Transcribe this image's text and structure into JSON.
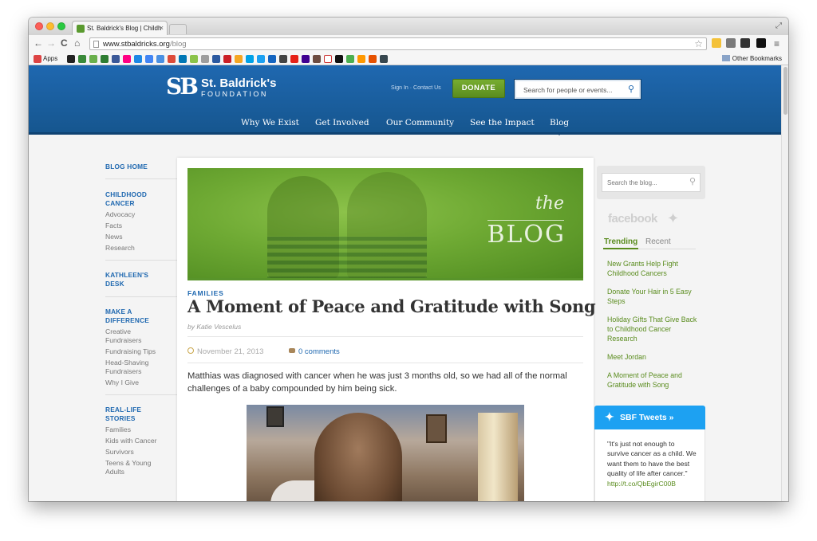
{
  "browser": {
    "tab_title": "St. Baldrick's Blog | Childh",
    "tab_close": "×",
    "url_host": "www.stbaldricks.org",
    "url_path": "/blog",
    "bookmarks_apps_label": "Apps",
    "other_bookmarks": "Other Bookmarks",
    "nav_back": "←",
    "nav_forward": "→",
    "nav_reload": "C",
    "nav_home": "⌂",
    "star": "☆",
    "menu": "≡",
    "fullscreen": "⤢"
  },
  "header": {
    "logo_mark": "SB",
    "logo_name": "St. Baldrick's",
    "logo_sub": "FOUNDATION",
    "util_links": "Sign In · Contact Us",
    "donate": "DONATE",
    "search_placeholder": "Search for people or events...",
    "nav": [
      "Why We Exist",
      "Get Involved",
      "Our Community",
      "See the Impact",
      "Blog"
    ]
  },
  "leftnav": {
    "blog_home": "BLOG HOME",
    "sections": [
      {
        "head": "CHILDHOOD CANCER",
        "items": [
          "Advocacy",
          "Facts",
          "News",
          "Research"
        ]
      },
      {
        "head": "KATHLEEN'S DESK",
        "items": []
      },
      {
        "head": "MAKE A DIFFERENCE",
        "items": [
          "Creative Fundraisers",
          "Fundraising Tips",
          "Head-Shaving Fundraisers",
          "Why I Give"
        ]
      },
      {
        "head": "REAL-LIFE STORIES",
        "items": [
          "Families",
          "Kids with Cancer",
          "Survivors",
          "Teens & Young Adults"
        ]
      }
    ]
  },
  "article": {
    "hero_the": "the",
    "hero_blog": "BLOG",
    "category": "FAMILIES",
    "title": "A Moment of Peace and Gratitude with Song",
    "byline": "by Katie Vescelus",
    "date": "November 21, 2013",
    "comments": "0 comments",
    "lede": "Matthias was diagnosed with cancer when he was just 3 months old, so we had all of the normal challenges of a baby compounded by him being sick."
  },
  "sidebar": {
    "search_placeholder": "Search the blog...",
    "facebook": "facebook",
    "tab_trending": "Trending",
    "tab_recent": "Recent",
    "trending": [
      "New Grants Help Fight Childhood Cancers",
      "Donate Your Hair in 5 Easy Steps",
      "Holiday Gifts That Give Back to Childhood Cancer Research",
      "Meet Jordan",
      "A Moment of Peace and Gratitude with Song"
    ],
    "tweets_title": "SBF Tweets »",
    "tweet_text": "\"It's just not enough to survive cancer as a child. We want them to have the best quality of life after cancer.\"",
    "tweet_link": "http://t.co/QbEgirC00B"
  },
  "colors": {
    "brand_blue": "#1f68b0",
    "brand_green": "#5a8c1e",
    "twitter_blue": "#1da1f2"
  }
}
